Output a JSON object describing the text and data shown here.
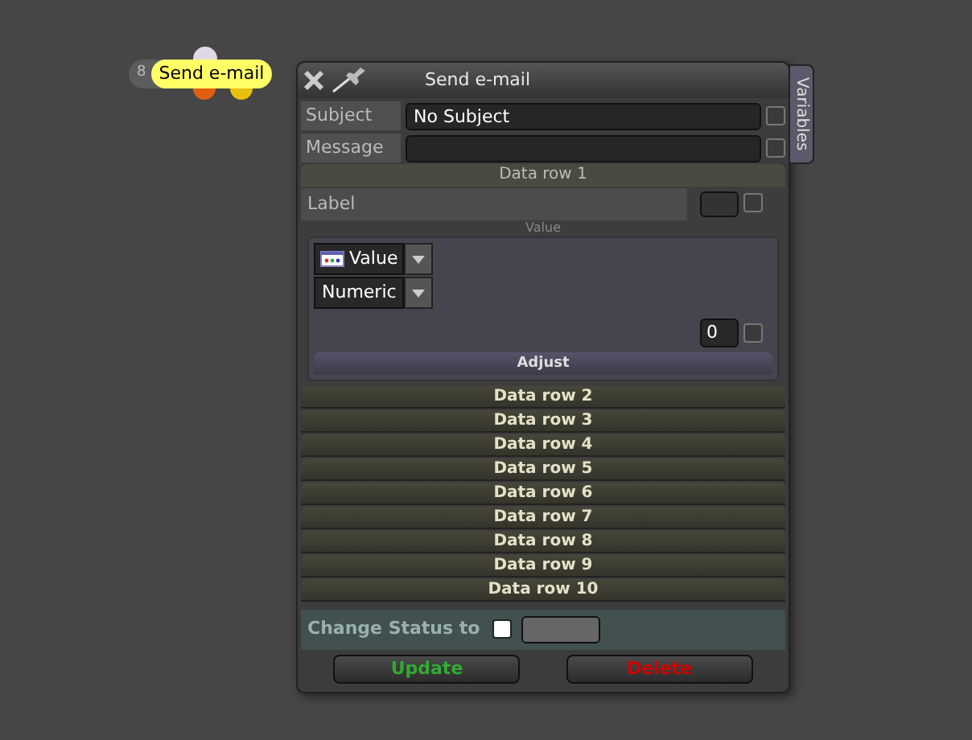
{
  "node": {
    "badge": "8",
    "label": "Send e-mail"
  },
  "panel": {
    "title": "Send e-mail",
    "side_tab": "Variables"
  },
  "fields": [
    {
      "label": "Subject",
      "value": "No Subject",
      "checked": false
    },
    {
      "label": "Message",
      "checked": false
    }
  ],
  "data_rows": [
    {
      "title": "Data row 1",
      "expanded": true,
      "label_value": "Label",
      "label_checked": false,
      "value_heading": "Value",
      "type_select": "Value",
      "format_select": "Numeric",
      "number": "0",
      "number_checked": false,
      "adjust": "Adjust"
    },
    {
      "title": "Data row 2",
      "expanded": false
    },
    {
      "title": "Data row 3",
      "expanded": false
    },
    {
      "title": "Data row 4",
      "expanded": false
    },
    {
      "title": "Data row 5",
      "expanded": false
    },
    {
      "title": "Data row 6",
      "expanded": false
    },
    {
      "title": "Data row 7",
      "expanded": false
    },
    {
      "title": "Data row 8",
      "expanded": false
    },
    {
      "title": "Data row 9",
      "expanded": false
    },
    {
      "title": "Data row 10",
      "expanded": false
    }
  ],
  "status": {
    "label": "Change Status to",
    "checked": false
  },
  "buttons": [
    {
      "label": "Update",
      "kind": "confirm"
    },
    {
      "label": "Delete",
      "kind": "danger"
    }
  ]
}
